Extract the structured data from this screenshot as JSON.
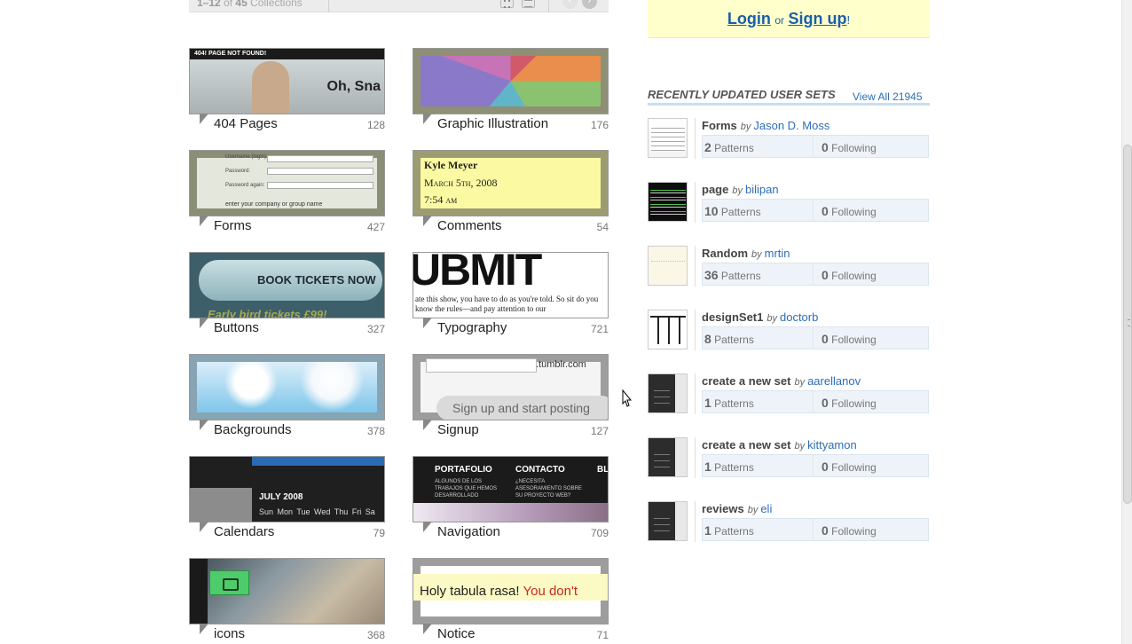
{
  "toolbar": {
    "range": "1–12",
    "of_label": "of",
    "total": "45",
    "unit": "Collections",
    "prev_icon": "chevron-left-icon",
    "next_icon": "chevron-right-icon"
  },
  "collections": [
    {
      "label": "404 Pages",
      "count": "128",
      "thumb": {
        "header": "404! PAGE NOT FOUND!",
        "text": "Oh, Sna"
      }
    },
    {
      "label": "Graphic Illustration",
      "count": "176"
    },
    {
      "label": "Forms",
      "count": "427",
      "thumb": {
        "rows": [
          "Username (login):",
          "Password:",
          "Password again:"
        ],
        "text": "enter your company or group name"
      }
    },
    {
      "label": "Comments",
      "count": "54",
      "thumb": {
        "lines": [
          "Kyle Meyer",
          "March 5th, 2008",
          "7:54 am"
        ]
      }
    },
    {
      "label": "Buttons",
      "count": "327",
      "thumb": {
        "button": "BOOK TICKETS NOW",
        "text": "Early bird tickets £99!"
      }
    },
    {
      "label": "Typography",
      "count": "721",
      "thumb": {
        "big": "UBMIT",
        "text": "ate this show, you have to do as you're told. So sit do you know the rules—and pay attention to our"
      }
    },
    {
      "label": "Backgrounds",
      "count": "378"
    },
    {
      "label": "Signup",
      "count": "127",
      "thumb": {
        "domain": ".tumblr.com",
        "button": "Sign up and start posting"
      }
    },
    {
      "label": "Calendars",
      "count": "79",
      "thumb": {
        "month": "JULY 2008",
        "days": "Sun Mon Tue Wed Thu Fri Sa"
      }
    },
    {
      "label": "Navigation",
      "count": "709",
      "thumb": {
        "items": [
          "PORTAFOLIO",
          "CONTACTO",
          "BL"
        ],
        "subs": [
          "ALGUNOS DE LOS TRABAJOS QUE HEMOS DESARROLLADO",
          "¿NECESITA ASESORAMIENTO SOBRE SU PROYECTO WEB?"
        ]
      }
    },
    {
      "label": "icons",
      "count": "368"
    },
    {
      "label": "Notice",
      "count": "71",
      "thumb": {
        "text": "Holy tabula rasa!",
        "highlight": "You don't"
      }
    }
  ],
  "auth": {
    "login": "Login",
    "or": "or",
    "signup": "Sign up",
    "bang": "!"
  },
  "sets": {
    "heading": "RECENTLY UPDATED USER SETS",
    "view_all": "View All 21945",
    "by": "by",
    "patterns_label": "Patterns",
    "following_label": "Following",
    "items": [
      {
        "name": "Forms",
        "author": "Jason D. Moss",
        "patterns": "2",
        "following": "0"
      },
      {
        "name": "page",
        "author": "bilipan",
        "patterns": "10",
        "following": "0"
      },
      {
        "name": "Random",
        "author": "mrtin",
        "patterns": "36",
        "following": "0"
      },
      {
        "name": "designSet1",
        "author": "doctorb",
        "patterns": "8",
        "following": "0"
      },
      {
        "name": "create a new set",
        "author": "aarellanov",
        "patterns": "1",
        "following": "0"
      },
      {
        "name": "create a new set",
        "author": "kittyamon",
        "patterns": "1",
        "following": "0"
      },
      {
        "name": "reviews",
        "author": "eli",
        "patterns": "1",
        "following": "0"
      }
    ]
  },
  "colors": {
    "link": "#1a5fa8",
    "login_bg": "#ffffcc",
    "stats_bg": "#eef3f9"
  }
}
